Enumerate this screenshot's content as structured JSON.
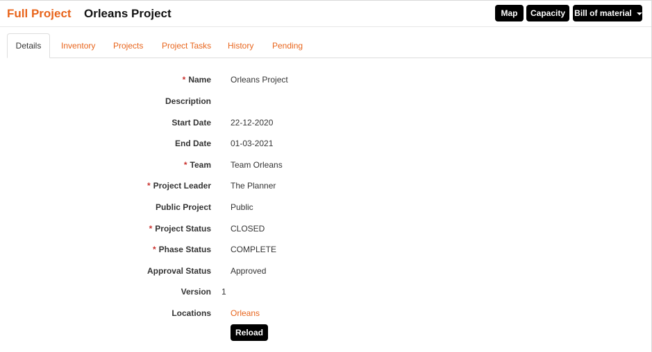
{
  "header": {
    "brand": "Full Project",
    "title": "Orleans Project",
    "buttons": {
      "map": "Map",
      "capacity": "Capacity",
      "bom": "Bill of material"
    }
  },
  "tabs": [
    {
      "label": "Details",
      "active": true
    },
    {
      "label": "Inventory"
    },
    {
      "label": "Projects"
    },
    {
      "label": "Project Tasks"
    },
    {
      "label": "History"
    },
    {
      "label": "Pending"
    }
  ],
  "fields": {
    "name": {
      "label": "Name",
      "value": "Orleans Project",
      "required": "*"
    },
    "description": {
      "label": "Description",
      "value": ""
    },
    "start_date": {
      "label": "Start Date",
      "value": "22-12-2020"
    },
    "end_date": {
      "label": "End Date",
      "value": "01-03-2021"
    },
    "team": {
      "label": "Team",
      "value": "Team Orleans",
      "required": "*"
    },
    "project_leader": {
      "label": "Project Leader",
      "value": "The Planner",
      "required": "*"
    },
    "public_project": {
      "label": "Public Project",
      "value": "Public"
    },
    "project_status": {
      "label": "Project Status",
      "value": "CLOSED",
      "required": "*"
    },
    "phase_status": {
      "label": "Phase Status",
      "value": "COMPLETE",
      "required": "*"
    },
    "approval_status": {
      "label": "Approval Status",
      "value": "Approved"
    },
    "version": {
      "label": "Version",
      "value": "1"
    },
    "locations": {
      "label": "Locations",
      "value": "Orleans"
    }
  },
  "actions": {
    "reload": "Reload"
  },
  "colors": {
    "accent": "#e8641b",
    "required": "#c9302c",
    "button_bg": "#000000"
  }
}
